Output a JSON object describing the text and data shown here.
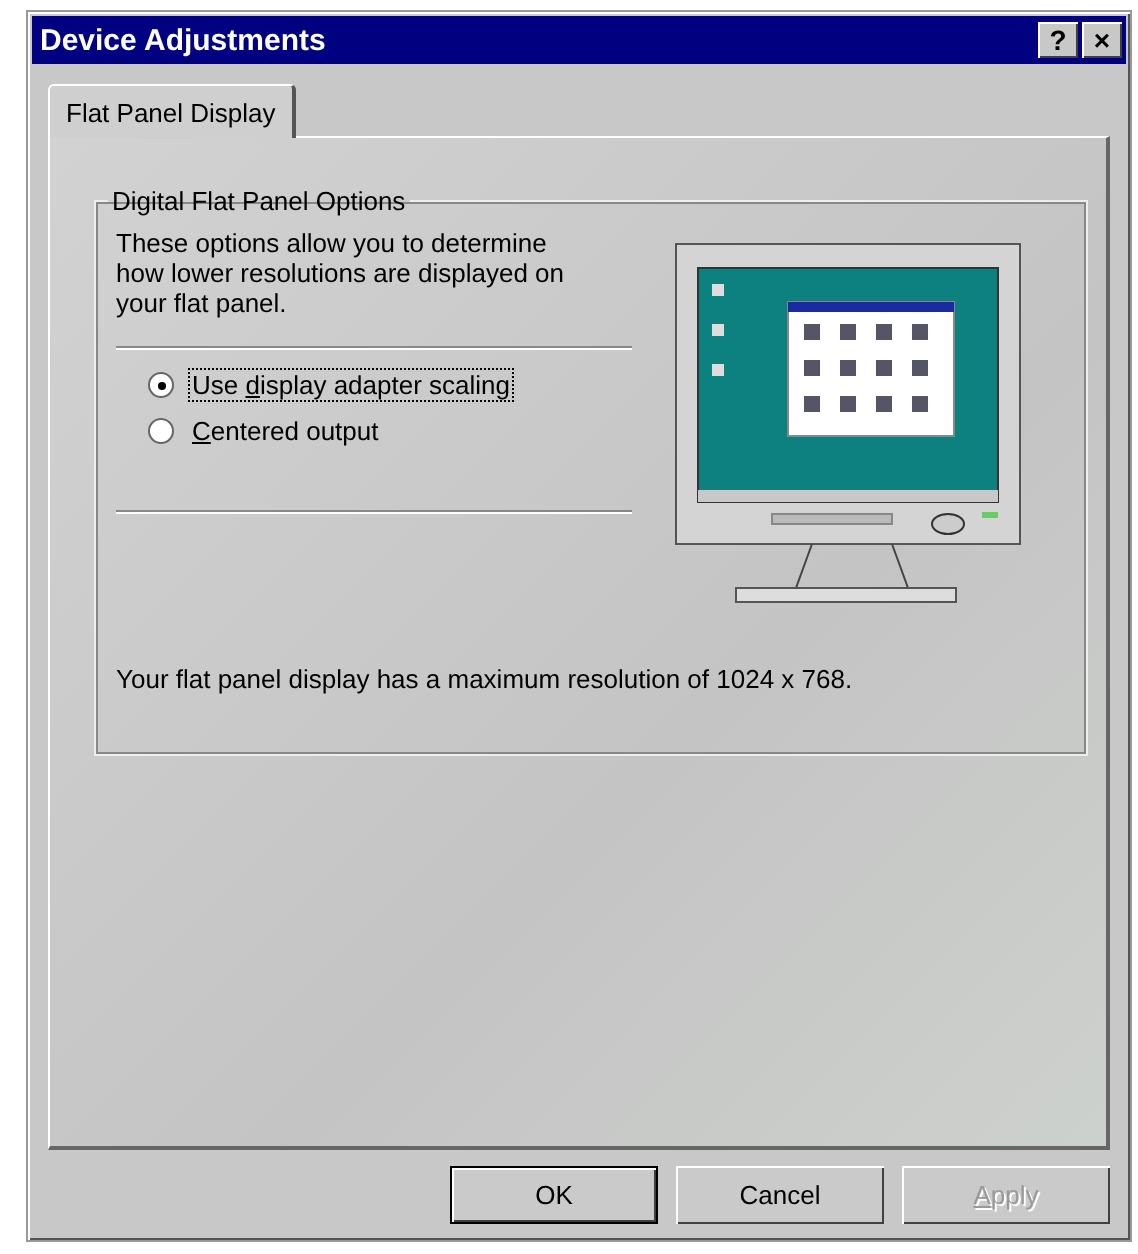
{
  "window": {
    "title": "Device Adjustments",
    "title_buttons": [
      "?",
      "×"
    ]
  },
  "tabs": [
    {
      "label": "Flat Panel Display",
      "selected": true
    }
  ],
  "group": {
    "title": "Digital Flat Panel Options",
    "description": "These options allow you to determine how lower resolutions are displayed on your flat panel.",
    "options": [
      {
        "before": "Use ",
        "key": "d",
        "after": "isplay adapter scaling",
        "selected": true,
        "focused": true
      },
      {
        "key": "C",
        "after": "entered output",
        "selected": false,
        "focused": false
      }
    ],
    "info": "Your flat panel display has a maximum resolution of 1024 x 768."
  },
  "buttons": [
    {
      "after": "OK",
      "default": true,
      "disabled": false
    },
    {
      "after": "Cancel",
      "default": false,
      "disabled": false
    },
    {
      "key": "A",
      "after": "pply",
      "default": false,
      "disabled": true
    }
  ]
}
